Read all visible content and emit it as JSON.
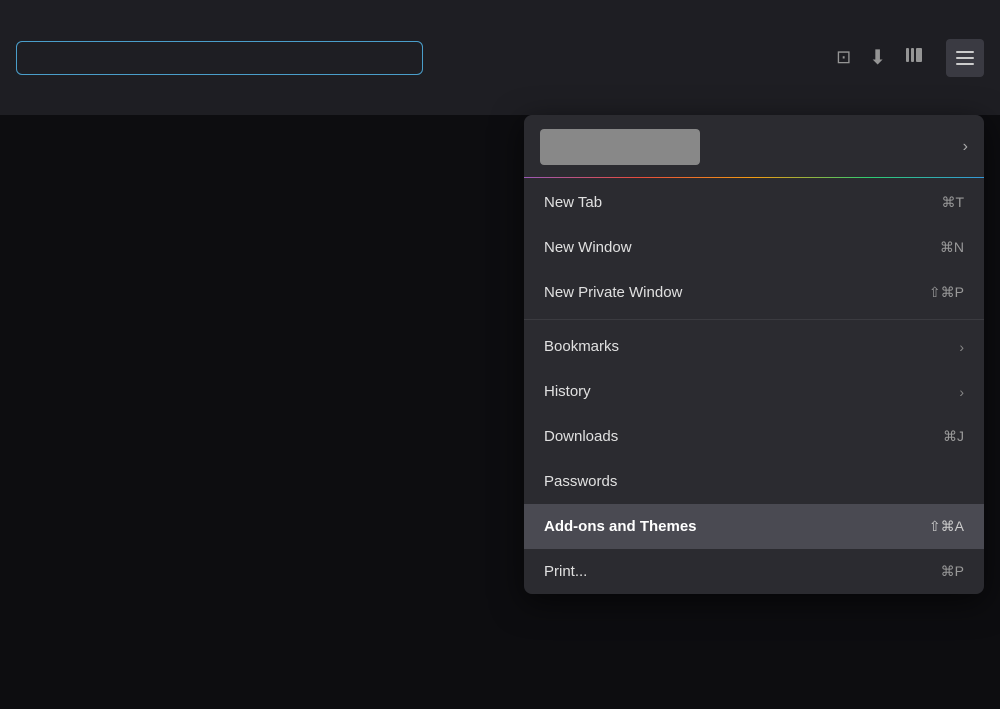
{
  "toolbar": {
    "address_placeholder": "",
    "icons": {
      "pocket": "🗂",
      "download": "⬇",
      "library": "📚",
      "menu": "≡"
    }
  },
  "menu": {
    "profile_label": "",
    "items": [
      {
        "id": "new-tab",
        "label": "New Tab",
        "shortcut": "⌘T",
        "has_chevron": false,
        "highlighted": false,
        "has_divider_after": false
      },
      {
        "id": "new-window",
        "label": "New Window",
        "shortcut": "⌘N",
        "has_chevron": false,
        "highlighted": false,
        "has_divider_after": false
      },
      {
        "id": "new-private-window",
        "label": "New Private Window",
        "shortcut": "⇧⌘P",
        "has_chevron": false,
        "highlighted": false,
        "has_divider_after": true
      },
      {
        "id": "bookmarks",
        "label": "Bookmarks",
        "shortcut": "",
        "has_chevron": true,
        "highlighted": false,
        "has_divider_after": false
      },
      {
        "id": "history",
        "label": "History",
        "shortcut": "",
        "has_chevron": true,
        "highlighted": false,
        "has_divider_after": false
      },
      {
        "id": "downloads",
        "label": "Downloads",
        "shortcut": "⌘J",
        "has_chevron": false,
        "highlighted": false,
        "has_divider_after": false
      },
      {
        "id": "passwords",
        "label": "Passwords",
        "shortcut": "",
        "has_chevron": false,
        "highlighted": false,
        "has_divider_after": false
      },
      {
        "id": "addons-themes",
        "label": "Add-ons and Themes",
        "shortcut": "⇧⌘A",
        "has_chevron": false,
        "highlighted": true,
        "has_divider_after": false
      },
      {
        "id": "print",
        "label": "Print...",
        "shortcut": "⌘P",
        "has_chevron": false,
        "highlighted": false,
        "has_divider_after": false
      }
    ]
  }
}
